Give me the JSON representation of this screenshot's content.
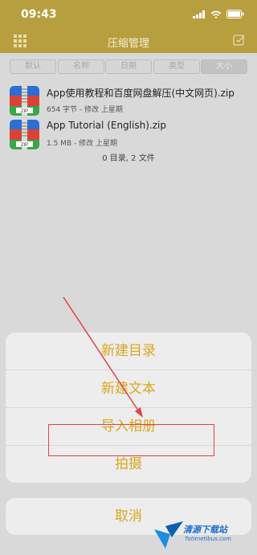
{
  "status": {
    "time": "09:43"
  },
  "nav": {
    "title": "压缩管理"
  },
  "tabs": [
    {
      "label": "默认"
    },
    {
      "label": "名称"
    },
    {
      "label": "日期"
    },
    {
      "label": "类型"
    },
    {
      "label": "大小"
    }
  ],
  "files": [
    {
      "name": "App使用教程和百度网盘解压(中文网页).zip",
      "meta": "654 字节 - 修改 上星期",
      "icon_label": "ZIP"
    },
    {
      "name": "App Tutorial (English).zip",
      "meta": "1.5 MB - 修改 上星期",
      "icon_label": "ZIP"
    }
  ],
  "summary": "0 目录, 2 文件",
  "sheet": {
    "items": [
      {
        "label": "新建目录"
      },
      {
        "label": "新建文本"
      },
      {
        "label": "导入相册"
      },
      {
        "label": "拍摄"
      }
    ],
    "cancel": "取消"
  },
  "watermark": {
    "title": "清源下载站",
    "sub": "Totimetibus.com"
  },
  "colors": {
    "accent": "#d9a81f",
    "nav": "#b79e3f",
    "highlight": "#e04545"
  }
}
